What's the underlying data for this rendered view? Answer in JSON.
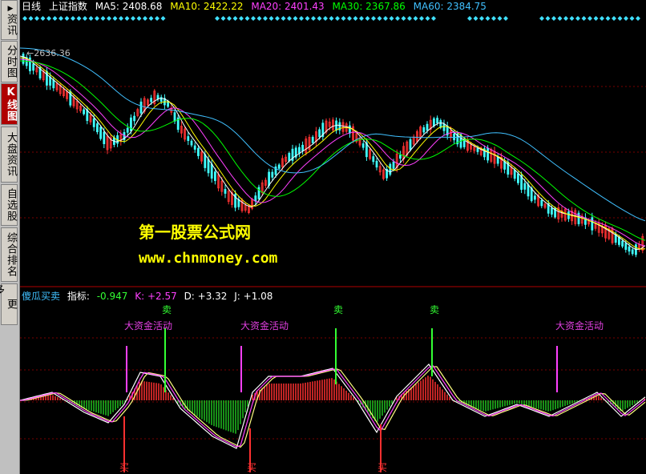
{
  "sidebar": {
    "items": [
      {
        "label": "资讯",
        "arrow": "▶"
      },
      {
        "label": "分时图"
      },
      {
        "label": "K线图"
      },
      {
        "label": "大盘资讯"
      },
      {
        "label": "自选股"
      },
      {
        "label": "综合排名"
      },
      {
        "label": "更多..."
      }
    ]
  },
  "header": {
    "period": "日线",
    "index_name": "上证指数",
    "ma5": "MA5: 2408.68",
    "ma10": "MA10: 2422.22",
    "ma20": "MA20: 2401.43",
    "ma30": "MA30: 2367.86",
    "ma60": "MA60: 2384.75"
  },
  "price_label": "2636.36",
  "watermark": {
    "line1": "第一股票公式网",
    "line2": "www.chnmoney.com"
  },
  "indicator": {
    "name": "傻瓜买卖",
    "label": "指标:",
    "value": "-0.947",
    "k": "K: +2.57",
    "d": "D: +3.32",
    "j": "J: +1.08"
  },
  "signals": {
    "big_fund": "大资金活动",
    "sell": "卖",
    "buy": "买"
  },
  "colors": {
    "ma5": "#ffffff",
    "ma10": "#ffff00",
    "ma20": "#ff40ff",
    "ma30": "#00ff00",
    "ma60": "#40c0ff",
    "up": "#ff3333",
    "down": "#40ffff",
    "panel_bg": "#000000"
  }
}
